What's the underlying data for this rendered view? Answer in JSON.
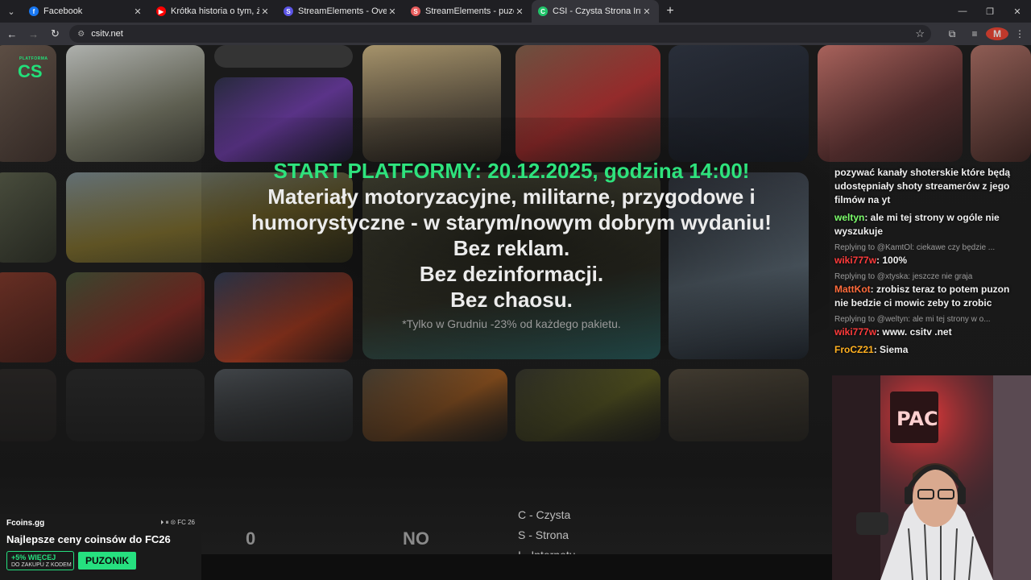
{
  "browser": {
    "tabs": [
      {
        "title": "Facebook",
        "favicon": "facebook-icon",
        "color": "#1877f2",
        "glyph": "f"
      },
      {
        "title": "Krótka historia o tym, że wracam",
        "favicon": "youtube-icon",
        "color": "#ff0000",
        "glyph": "▶"
      },
      {
        "title": "StreamElements - Overlays",
        "favicon": "streamelements-icon",
        "color": "#5b54e6",
        "glyph": "S"
      },
      {
        "title": "StreamElements - puzonik",
        "favicon": "streamelements-icon",
        "color": "#e85c5c",
        "glyph": "S"
      },
      {
        "title": "CSI - Czysta Strona Internetu",
        "favicon": "csi-icon",
        "color": "#21c46a",
        "glyph": "C"
      }
    ],
    "active_tab": 4,
    "url": "csitv.net",
    "profile_initial": "M"
  },
  "site": {
    "logo_small": "PLATFORMA",
    "logo_mark": "CS",
    "hero_line1": "START PLATFORMY: 20.12.2025, godzina 14:00!",
    "hero_line2": "Materiały motoryzacyjne, militarne, przygodowe i",
    "hero_line3": "humorystyczne - w starym/nowym dobrym wydaniu!",
    "hero_line4": "Bez reklam.",
    "hero_line5": "Bez dezinformacji.",
    "hero_line6": "Bez chaosu.",
    "hero_note": "*Tylko w Grudniu -23% od każdego pakietu.",
    "bottom_num_left": "0",
    "bottom_num_right": "NO",
    "csi_lines": [
      "C - Czysta",
      "S - Strona",
      "I - Internetu"
    ]
  },
  "chat": {
    "messages": [
      {
        "text": "pozywać kanały shoterskie które będą udostępniały shoty streamerów z jego filmów na yt"
      },
      {
        "user": "weltyn",
        "user_color": "#7cff6b",
        "text": ": ale mi tej strony w ogóle nie wyszukuje"
      },
      {
        "reply": "Replying to @KamtOl: ciekawe czy będzie ...",
        "user": "wiki777w",
        "user_color": "#ff3b3b",
        "text": ": 100%"
      },
      {
        "reply": "Replying to @xtyska: jeszcze nie graja",
        "user": "MattKot",
        "user_color": "#ff6b3b",
        "text": ": zrobisz teraz to potem puzon nie bedzie ci mowic zeby to zrobic"
      },
      {
        "reply": "Replying to @weltyn: ale mi tej strony w o...",
        "user": "wiki777w",
        "user_color": "#ff3b3b",
        "text": ": www. csitv .net"
      },
      {
        "user": "FroCZ21",
        "user_color": "#ffb020",
        "text": ": Siema"
      }
    ]
  },
  "promo": {
    "brand": "Fcoins.gg",
    "platforms": "FC 26",
    "headline": "Najlepsze ceny coinsów do FC26",
    "discount": "+5% WIĘCEJ",
    "discount_sub": "DO ZAKUPU Z KODEM",
    "code": "PUZONIK"
  }
}
